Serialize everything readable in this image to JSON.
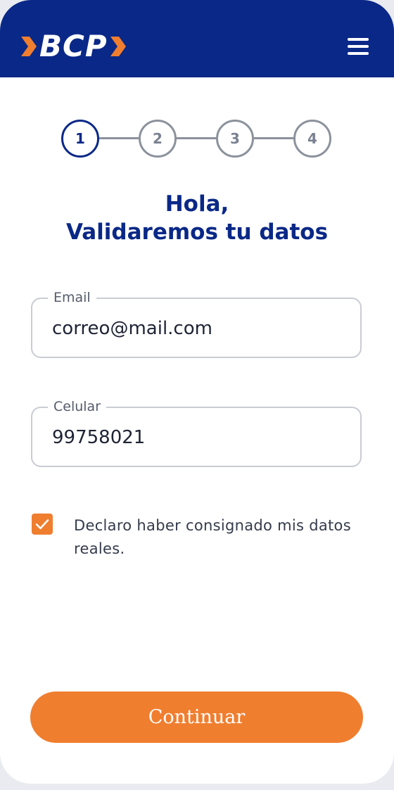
{
  "header": {
    "logo_text": "BCP",
    "logo_icon": "bcp-chevron-icon",
    "menu_icon": "hamburger-menu-icon"
  },
  "colors": {
    "brand_blue": "#0a2887",
    "accent_orange": "#f07e2f",
    "inactive_gray": "#8c929c"
  },
  "stepper": {
    "steps": [
      "1",
      "2",
      "3",
      "4"
    ],
    "current_step": 1
  },
  "title": {
    "line1": "Hola,",
    "line2": "Validaremos tu datos"
  },
  "form": {
    "email": {
      "label": "Email",
      "value": "correo@mail.com"
    },
    "phone": {
      "label": "Celular",
      "value": "99758021"
    },
    "declaration": {
      "checked": true,
      "text": "Declaro haber consignado mis datos reales."
    }
  },
  "cta": {
    "label": "Continuar"
  }
}
